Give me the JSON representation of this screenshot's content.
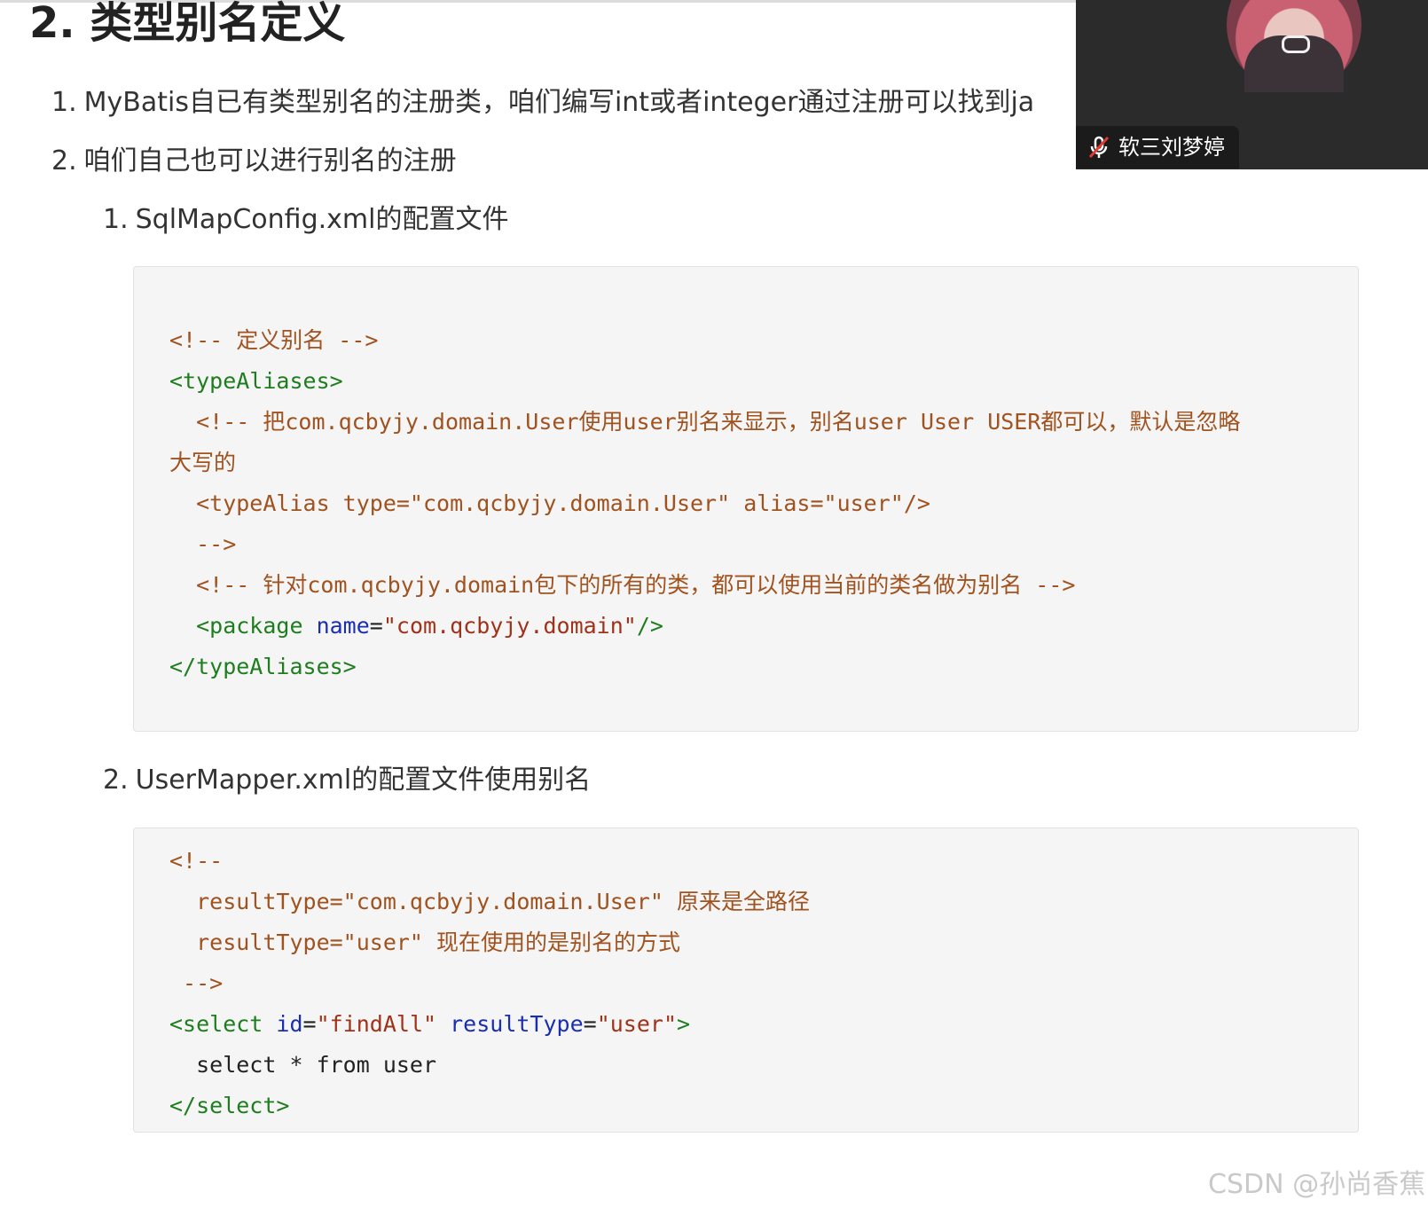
{
  "heading": "2. 类型别名定义",
  "list": [
    {
      "num": "1.",
      "text": "MyBatis自已有类型别名的注册类，咱们编写int或者integer通过注册可以找到ja"
    },
    {
      "num": "2.",
      "text": "咱们自己也可以进行别名的注册"
    }
  ],
  "sublist": [
    {
      "num": "1.",
      "text": "SqlMapConfig.xml的配置文件"
    },
    {
      "num": "2.",
      "text": "UserMapper.xml的配置文件使用别名"
    }
  ],
  "code1": {
    "l1": "<!-- 定义别名 -->",
    "l2_tag": "<typeAliases>",
    "l3": "  <!-- 把com.qcbyjy.domain.User使用user别名来显示，别名user User USER都可以，默认是忽略",
    "l4": "大写的",
    "l5": "  <typeAlias type=\"com.qcbyjy.domain.User\" alias=\"user\"/>",
    "l6": "  -->",
    "l7": "  <!-- 针对com.qcbyjy.domain包下的所有的类，都可以使用当前的类名做为别名 -->",
    "l8_tag_open": "  <package",
    "l8_attr": "name",
    "l8_eq": "=",
    "l8_val": "\"com.qcbyjy.domain\"",
    "l8_close": "/>",
    "l9_tag": "</typeAliases>"
  },
  "code2": {
    "l1": "<!--",
    "l2": "  resultType=\"com.qcbyjy.domain.User\" 原来是全路径",
    "l3": "  resultType=\"user\" 现在使用的是别名的方式",
    "l4": " -->",
    "l5_tag_open": "<select",
    "l5_attr1": "id",
    "l5_eq1": "=",
    "l5_val1": "\"findAll\"",
    "l5_attr2": "resultType",
    "l5_eq2": "=",
    "l5_val2": "\"user\"",
    "l5_close": ">",
    "l6": "  select * from user",
    "l7_tag": "</select>"
  },
  "video": {
    "participant_name": "软三刘梦婷",
    "mic_icon": "mic-muted-icon"
  },
  "watermark": "CSDN @孙尚香蕉"
}
